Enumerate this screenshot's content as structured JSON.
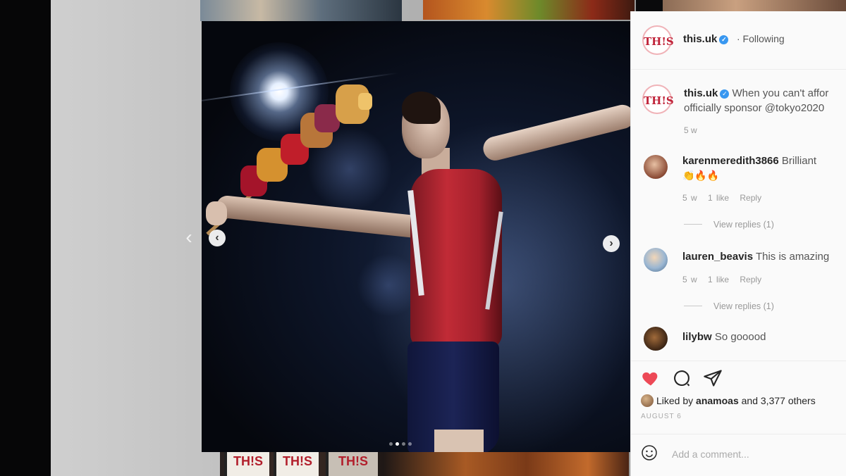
{
  "post": {
    "username": "this.uk",
    "logo_text": "TH!S",
    "follow_status": "· Following",
    "caption_user": "this.uk",
    "caption_text": "When you can't affor",
    "caption_text_line2": "officially sponsor @tokyo2020",
    "caption_time": "5 w"
  },
  "comments": [
    {
      "user": "karenmeredith3866",
      "text": "Brilliant",
      "emoji_line": "👏🔥🔥",
      "time": "5 w",
      "likes": "1 like",
      "reply": "Reply",
      "view_replies": "View replies (1)"
    },
    {
      "user": "lauren_beavis",
      "text": "This is amazing",
      "time": "5 w",
      "likes": "1 like",
      "reply": "Reply",
      "view_replies": "View replies (1)"
    },
    {
      "user": "lilybw",
      "text": "So gooood"
    }
  ],
  "liked_by": {
    "prefix": "Liked by",
    "user": "anamoas",
    "suffix": "and 3,377 others"
  },
  "post_date": "AUGUST 6",
  "add_comment_placeholder": "Add a comment...",
  "carousel": {
    "prev_glyph": "‹",
    "next_glyph": "›",
    "outer_glyph": "‹",
    "slide_count": 4,
    "active_index": 1
  },
  "icons": {
    "like": "heart-icon",
    "comment": "comment-icon",
    "share": "paper-plane-icon",
    "emoji": "smiley-icon",
    "verified": "verified-badge-icon"
  },
  "colors": {
    "like_red": "#ed4956",
    "verified_blue": "#3897f0",
    "brand_red": "#c0243a"
  },
  "thumbnails": {
    "pack_text": "TH!S"
  }
}
